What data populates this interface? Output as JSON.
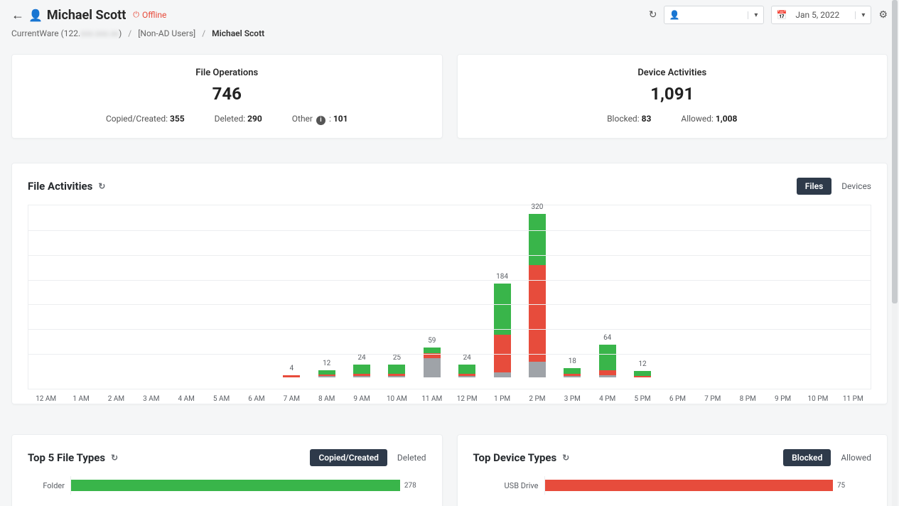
{
  "header": {
    "title": "Michael Scott",
    "status_label": "Offline",
    "date_label": "Jan 5, 2022",
    "user_value": ""
  },
  "breadcrumb": {
    "root": "CurrentWare (122.",
    "root_suffix": ")",
    "group": "[Non-AD Users]",
    "current": "Michael Scott"
  },
  "stats": {
    "file_ops": {
      "title": "File Operations",
      "value": "746",
      "copied_label": "Copied/Created:",
      "copied_val": "355",
      "deleted_label": "Deleted:",
      "deleted_val": "290",
      "other_label": "Other",
      "other_sep": ":",
      "other_val": "101"
    },
    "device": {
      "title": "Device Activities",
      "value": "1,091",
      "blocked_label": "Blocked:",
      "blocked_val": "83",
      "allowed_label": "Allowed:",
      "allowed_val": "1,008"
    }
  },
  "file_activities": {
    "title": "File Activities",
    "tab_files": "Files",
    "tab_devices": "Devices"
  },
  "top_file_types": {
    "title": "Top 5 File Types",
    "tab_copied": "Copied/Created",
    "tab_deleted": "Deleted"
  },
  "top_device_types": {
    "title": "Top Device Types",
    "tab_blocked": "Blocked",
    "tab_allowed": "Allowed"
  },
  "chart_data": [
    {
      "id": "file_activities",
      "type": "bar",
      "stacked": true,
      "title": "File Activities",
      "xlabel": "",
      "ylabel": "",
      "ylim": [
        0,
        340
      ],
      "categories": [
        "12 AM",
        "1 AM",
        "2 AM",
        "3 AM",
        "4 AM",
        "5 AM",
        "6 AM",
        "7 AM",
        "8 AM",
        "9 AM",
        "10 AM",
        "11 AM",
        "12 PM",
        "1 PM",
        "2 PM",
        "3 PM",
        "4 PM",
        "5 PM",
        "6 PM",
        "7 PM",
        "8 PM",
        "9 PM",
        "10 PM",
        "11 PM"
      ],
      "totals": [
        0,
        0,
        0,
        0,
        0,
        0,
        0,
        4,
        12,
        24,
        25,
        59,
        24,
        184,
        320,
        18,
        64,
        12,
        0,
        0,
        0,
        0,
        0,
        0
      ],
      "series": [
        {
          "name": "Copied/Created",
          "color": "#39b54a",
          "values": [
            0,
            0,
            0,
            0,
            0,
            0,
            0,
            0,
            8,
            18,
            19,
            12,
            18,
            100,
            100,
            12,
            50,
            10,
            0,
            0,
            0,
            0,
            0,
            0
          ]
        },
        {
          "name": "Deleted",
          "color": "#e74c3c",
          "values": [
            0,
            0,
            0,
            0,
            0,
            0,
            0,
            4,
            3,
            4,
            4,
            10,
            4,
            74,
            190,
            4,
            10,
            2,
            0,
            0,
            0,
            0,
            0,
            0
          ]
        },
        {
          "name": "Other",
          "color": "#9fa3a8",
          "values": [
            0,
            0,
            0,
            0,
            0,
            0,
            0,
            0,
            1,
            2,
            2,
            37,
            2,
            10,
            30,
            2,
            4,
            0,
            0,
            0,
            0,
            0,
            0,
            0
          ]
        }
      ]
    },
    {
      "id": "top_file_types",
      "type": "bar",
      "orientation": "horizontal",
      "title": "Top 5 File Types — Copied/Created",
      "categories": [
        "Folder"
      ],
      "values": [
        278
      ],
      "xlim": [
        0,
        300
      ],
      "color": "#39b54a"
    },
    {
      "id": "top_device_types",
      "type": "bar",
      "orientation": "horizontal",
      "title": "Top Device Types — Blocked",
      "categories": [
        "USB Drive"
      ],
      "values": [
        75
      ],
      "xlim": [
        0,
        85
      ],
      "color": "#e74c3c"
    }
  ]
}
